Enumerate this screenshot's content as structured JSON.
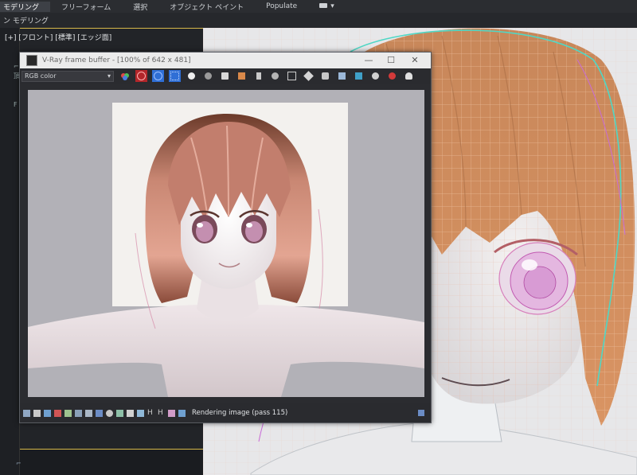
{
  "ribbon": {
    "tabs": [
      "モデリング",
      "フリーフォーム",
      "選択",
      "オブジェクト ペイント",
      "Populate"
    ],
    "active_index": 0,
    "subtitle": "ン モデリング"
  },
  "viewport": {
    "label": "[+] [フロント] [標準] [エッジ面]"
  },
  "vfb": {
    "title": "V-Ray frame buffer - [100% of 642 x 481]",
    "channel": "RGB color",
    "status": "Rendering image (pass 115)",
    "accent": "#2f6fd6"
  },
  "icons": {
    "toolbar": [
      "color-channels-icon",
      "red-channel-icon",
      "green-channel-icon",
      "blue-channel-icon",
      "alpha-channel-icon",
      "mono-channel-icon",
      "save-image-icon",
      "load-image-icon",
      "clear-image-icon",
      "region-render-icon",
      "track-mouse-icon",
      "pixel-info-icon",
      "link-to-viewport-icon",
      "color-correction-icon",
      "lens-effects-icon",
      "render-last-icon",
      "stop-render-icon",
      "ipr-icon"
    ]
  }
}
